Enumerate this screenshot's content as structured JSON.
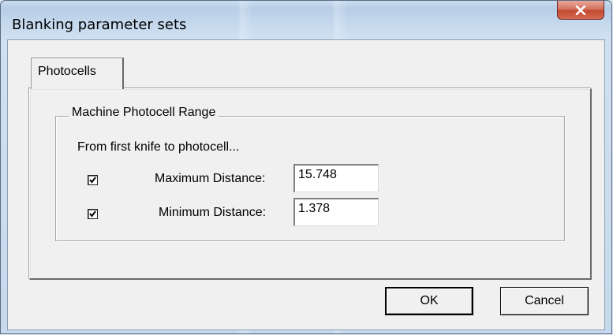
{
  "window": {
    "title": "Blanking parameter sets",
    "close_icon": "close-icon"
  },
  "tabs": [
    {
      "label": "Photocells",
      "selected": true
    }
  ],
  "group": {
    "legend": "Machine Photocell Range",
    "hint": "From first knife to photocell...",
    "rows": [
      {
        "checked": true,
        "label": "Maximum Distance:",
        "value": "15.748"
      },
      {
        "checked": true,
        "label": "Minimum Distance:",
        "value": "1.378"
      }
    ]
  },
  "buttons": {
    "ok_label": "OK",
    "cancel_label": "Cancel"
  },
  "colors": {
    "frame": "#c6d9ec",
    "client": "#f0f0f0",
    "close_button": "#c24a33"
  }
}
